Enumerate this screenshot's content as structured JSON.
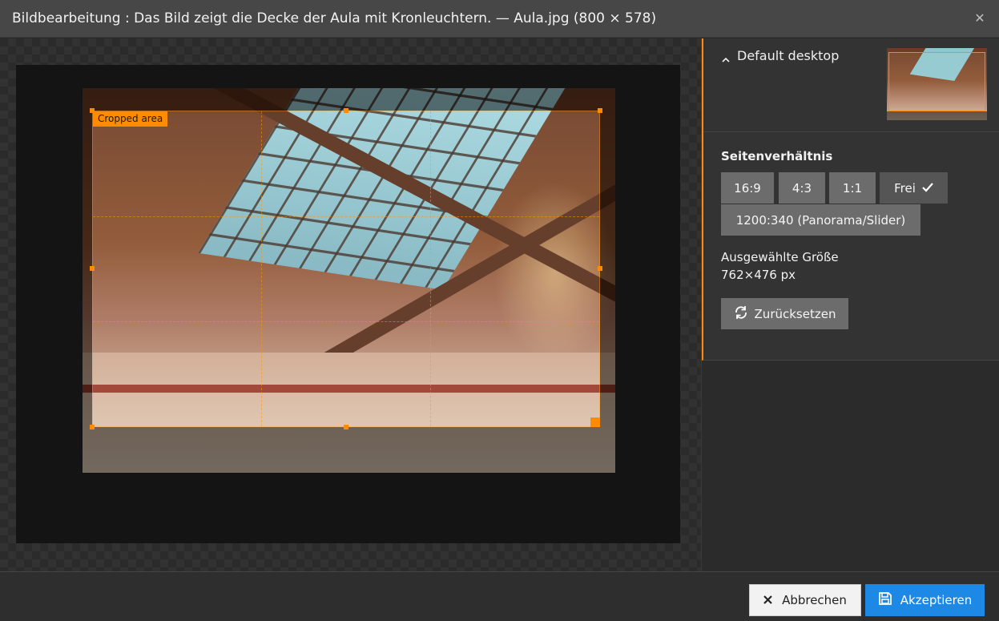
{
  "dialog": {
    "title": "Bildbearbeitung : Das Bild zeigt die Decke der Aula mit Kronleuchtern. — Aula.jpg (800 × 578)",
    "close_icon": "close-icon"
  },
  "editor": {
    "crop_label": "Cropped area"
  },
  "sidebar": {
    "preset_name": "Default desktop",
    "preset_icon": "chevron-up-icon",
    "aspect_ratio_heading": "Seitenverhältnis",
    "aspect_ratios": [
      {
        "label": "16:9",
        "active": false
      },
      {
        "label": "4:3",
        "active": false
      },
      {
        "label": "1:1",
        "active": false
      },
      {
        "label": "Frei",
        "active": true
      },
      {
        "label": "1200:340 (Panorama/Slider)",
        "active": false
      }
    ],
    "selected_size_label": "Ausgewählte Größe",
    "selected_size_value": "762×476 px",
    "reset_label": "Zurücksetzen",
    "reset_icon": "refresh-icon"
  },
  "footer": {
    "cancel_label": "Abbrechen",
    "cancel_icon": "close-icon",
    "accept_label": "Akzeptieren",
    "accept_icon": "save-icon"
  },
  "colors": {
    "accent": "#ff8c00",
    "primary_button": "#1e88e5"
  }
}
